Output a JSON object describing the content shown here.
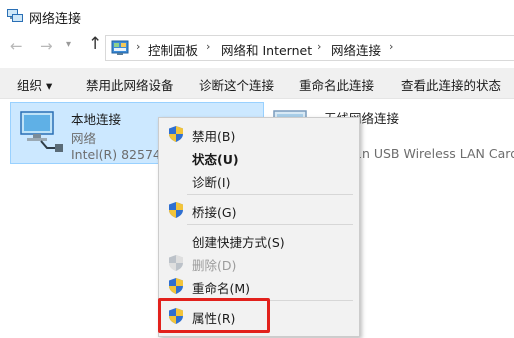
{
  "window": {
    "title": "网络连接"
  },
  "address": {
    "crumbs": [
      "控制面板",
      "网络和 Internet",
      "网络连接"
    ]
  },
  "toolbar": {
    "organize": "组织 ▾",
    "disable": "禁用此网络设备",
    "diagnose": "诊断这个连接",
    "rename": "重命名此连接",
    "status": "查看此连接的状态"
  },
  "connections": [
    {
      "name": "本地连接",
      "status": "网络",
      "device": "Intel(R) 82574L",
      "selected": true
    },
    {
      "name": "无线网络连接",
      "status": "",
      "device": "1n USB Wireless LAN Card",
      "selected": false
    }
  ],
  "context_menu": {
    "items": [
      {
        "label": "禁用(B)",
        "shield": true,
        "bold": false,
        "disabled": false
      },
      {
        "label": "状态(U)",
        "shield": false,
        "bold": true,
        "disabled": false
      },
      {
        "label": "诊断(I)",
        "shield": false,
        "bold": false,
        "disabled": false
      },
      {
        "label": "桥接(G)",
        "shield": true,
        "bold": false,
        "disabled": false
      },
      {
        "label": "创建快捷方式(S)",
        "shield": false,
        "bold": false,
        "disabled": false
      },
      {
        "label": "删除(D)",
        "shield": true,
        "bold": false,
        "disabled": true
      },
      {
        "label": "重命名(M)",
        "shield": true,
        "bold": false,
        "disabled": false
      },
      {
        "label": "属性(R)",
        "shield": true,
        "bold": false,
        "disabled": false,
        "highlighted": true
      }
    ]
  },
  "colors": {
    "selection": "#cce8ff",
    "highlight_box": "#e2211c",
    "menu_bg": "#f2f2f2"
  }
}
